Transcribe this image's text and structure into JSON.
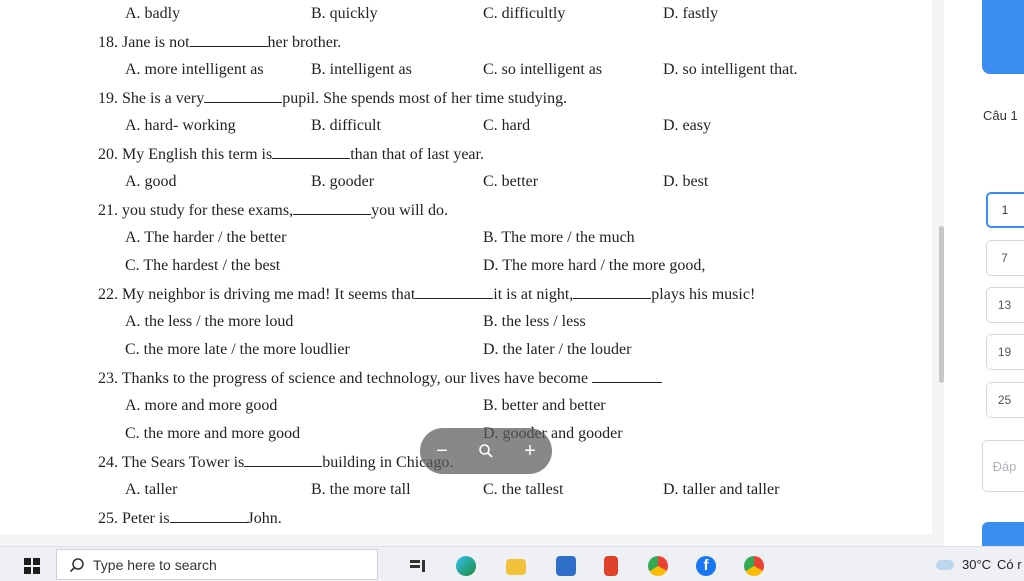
{
  "questions": {
    "q17_options": [
      "A. badly",
      "B. quickly",
      "C. difficultly",
      "D. fastly"
    ],
    "q18": {
      "pre": "18. Jane is not",
      "post": "her brother.",
      "options": [
        "A. more intelligent as",
        "B. intelligent as",
        "C. so intelligent as",
        "D. so intelligent that."
      ]
    },
    "q19": {
      "pre": "19. She is a very",
      "post": "pupil. She spends most of her time studying.",
      "options": [
        "A. hard- working",
        "B. difficult",
        "C. hard",
        "D. easy"
      ]
    },
    "q20": {
      "pre": "20. My English this term is",
      "post": "than that of last year.",
      "options": [
        "A. good",
        "B. gooder",
        "C. better",
        "D. best"
      ]
    },
    "q21": {
      "pre": "21. you study for these exams,",
      "post": "you will do.",
      "options": [
        "A. The harder / the better",
        "B. The more / the much",
        "C. The hardest / the best",
        "D. The more hard / the more good,"
      ]
    },
    "q22": {
      "pre": "22. My neighbor is driving me mad! It seems that",
      "mid": "it is at night,",
      "post": "plays his music!",
      "options": [
        "A. the less / the more loud",
        "B. the less / less",
        "C. the more late / the more loudlier",
        "D. the later / the louder"
      ]
    },
    "q23": {
      "pre": "23. Thanks to the progress of science and technology, our lives have become",
      "options": [
        "A. more and more good",
        "B. better and better",
        "C. the more and more good",
        "D. gooder and gooder"
      ]
    },
    "q24": {
      "pre": "24. The Sears Tower is",
      "post": "building in Chicago.",
      "options": [
        "A. taller",
        "B. the more tall",
        "C. the tallest",
        "D. taller and taller"
      ]
    },
    "q25": {
      "pre": "25. Peter is",
      "post": "John."
    }
  },
  "sidebar": {
    "cau_label": "Câu 1",
    "question_buttons": [
      "1",
      "7",
      "13",
      "19",
      "25"
    ],
    "answer_label": "Đáp"
  },
  "zoom": {
    "minus": "−",
    "magnifier": "magnifier-icon",
    "plus": "+"
  },
  "taskbar": {
    "search_placeholder": "Type here to search",
    "weather": "30°C",
    "weather_desc": "Có r"
  },
  "colors": {
    "accent": "#3b8ef0"
  }
}
